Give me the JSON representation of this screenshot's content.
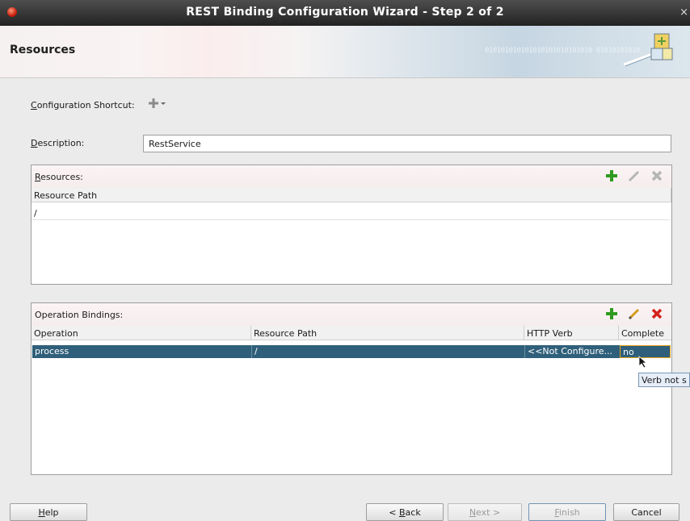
{
  "window": {
    "title": "REST Binding Configuration Wizard - Step 2 of 2",
    "close": "×"
  },
  "header": {
    "title": "Resources",
    "binary_text": "010101010101010101010101010 01010101010"
  },
  "shortcut": {
    "label_mnemonic": "C",
    "label_rest": "onfiguration Shortcut:",
    "icon": "plus-dropdown-icon"
  },
  "description": {
    "label_mnemonic": "D",
    "label_rest": "escription:",
    "value": "RestService"
  },
  "resources": {
    "label_mnemonic": "R",
    "label_rest": "esources:",
    "column": "Resource Path",
    "rows": [
      "/"
    ]
  },
  "operations": {
    "label": "Operation Bindings:",
    "columns": [
      "Operation",
      "Resource Path",
      "HTTP Verb",
      "Complete"
    ],
    "rows": [
      {
        "operation": "process",
        "path": "/",
        "verb": "<<Not Configure...",
        "complete": "no"
      }
    ]
  },
  "tooltip": "Verb not s",
  "buttons": {
    "help_mnemonic": "H",
    "help_rest": "elp",
    "back_prefix": "< ",
    "back_mnemonic": "B",
    "back_rest": "ack",
    "next_mnemonic": "N",
    "next_rest": "ext >",
    "finish_mnemonic": "F",
    "finish_rest": "inish",
    "cancel": "Cancel"
  },
  "colors": {
    "selection": "#2f5f7a",
    "add_icon": "#2e9a1f",
    "delete_active": "#d2231b"
  }
}
